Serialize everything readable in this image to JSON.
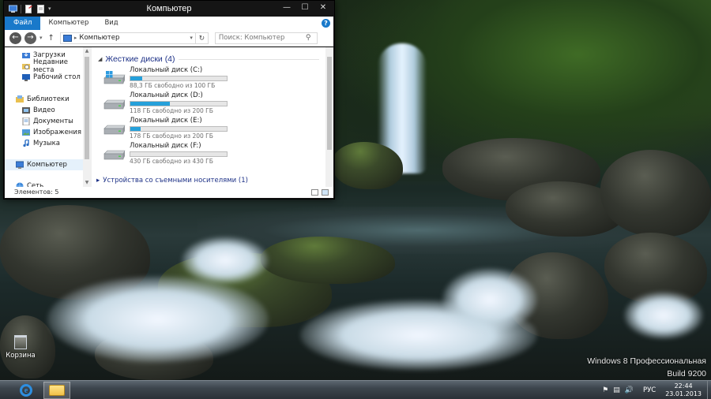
{
  "window": {
    "title": "Компьютер",
    "controls": {
      "minimize": "—",
      "maximize": "☐",
      "close": "✕"
    }
  },
  "ribbon": {
    "tabs": [
      "Файл",
      "Компьютер",
      "Вид"
    ],
    "help": "?"
  },
  "addressbar": {
    "path": "Компьютер",
    "search_placeholder": "Поиск: Компьютер"
  },
  "navpane": {
    "favorites": [
      "Загрузки",
      "Недавние места",
      "Рабочий стол"
    ],
    "libraries_header": "Библиотеки",
    "libraries": [
      "Видео",
      "Документы",
      "Изображения",
      "Музыка"
    ],
    "computer": "Компьютер",
    "network": "Сеть"
  },
  "main": {
    "group_title": "Жесткие диски (4)",
    "drives": [
      {
        "name": "Локальный диск (C:)",
        "free_text": "88,3 ГБ свободно из 100 ГБ",
        "used_fraction": 0.12,
        "icon": "windows-drive-icon"
      },
      {
        "name": "Локальный диск (D:)",
        "free_text": "118 ГБ свободно из 200 ГБ",
        "used_fraction": 0.41,
        "icon": "hard-drive-icon"
      },
      {
        "name": "Локальный диск (E:)",
        "free_text": "178 ГБ свободно из 200 ГБ",
        "used_fraction": 0.11,
        "icon": "hard-drive-icon"
      },
      {
        "name": "Локальный диск (F:)",
        "free_text": "430 ГБ свободно из 430 ГБ",
        "used_fraction": 0.0,
        "icon": "hard-drive-icon"
      }
    ],
    "next_group_partial": "Устройства со съемными носителями (1)"
  },
  "statusbar": {
    "items_count": "Элементов: 5"
  },
  "desktop": {
    "recycle_bin_label": "Корзина",
    "watermark_line1": "Windows 8 Профессиональная",
    "watermark_line2": "Build 9200"
  },
  "taskbar": {
    "apps": [
      "internet-explorer",
      "file-explorer"
    ],
    "language": "РУС",
    "time": "22:44",
    "date": "23.01.2013"
  },
  "colors": {
    "accent": "#1979ca",
    "drive_bar_fill": "#26a0da",
    "group_header": "#1e3287"
  }
}
